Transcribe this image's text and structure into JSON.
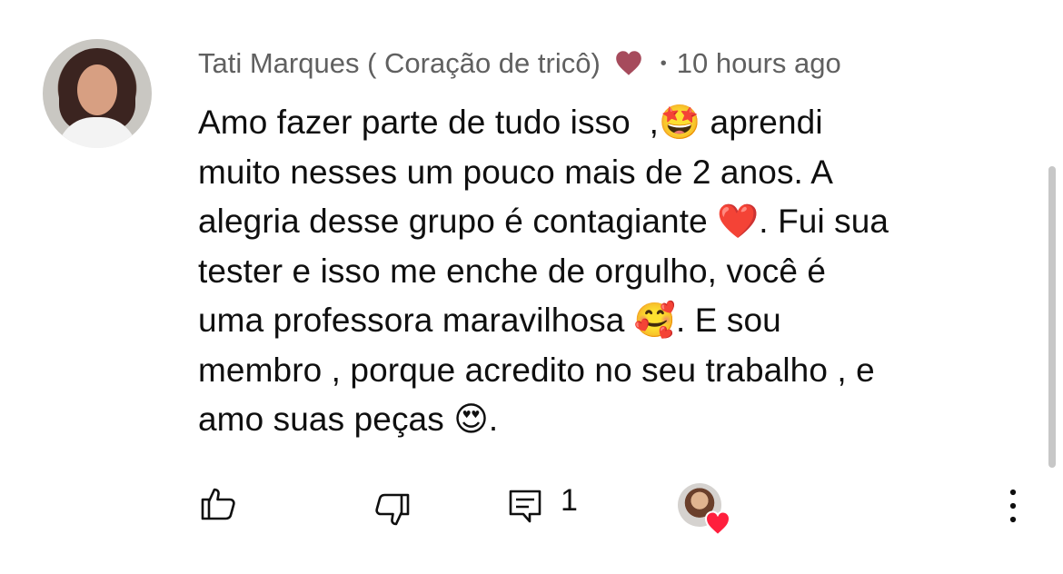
{
  "comment": {
    "author": "Tati Marques ( Coração de tricô)",
    "author_badge_icon": "heart-icon",
    "separator": "•",
    "timestamp": "10 hours ago",
    "text": "Amo fazer parte de tudo isso  ,🤩 aprendi\nmuito nesses um pouco mais de 2 anos. A\nalegria desse grupo é contagiante ❤️. Fui sua\ntester e isso me enche de orgulho, você é\numa professora maravilhosa 🥰. E sou\nmembro , porque acredito no seu trabalho , e\namo suas peças 😍.",
    "reply_count": "1"
  },
  "actions": {
    "like_icon": "thumb-up-icon",
    "dislike_icon": "thumb-down-icon",
    "reply_icon": "comment-icon",
    "creator_heart_icon": "creator-heart-icon",
    "more_icon": "more-vertical-icon"
  },
  "colors": {
    "background": "#ffffff",
    "text": "#0f0f0f",
    "secondary_text": "#606060",
    "heart_red": "#ff1f3d",
    "badge_heart": "#a64b5c"
  }
}
